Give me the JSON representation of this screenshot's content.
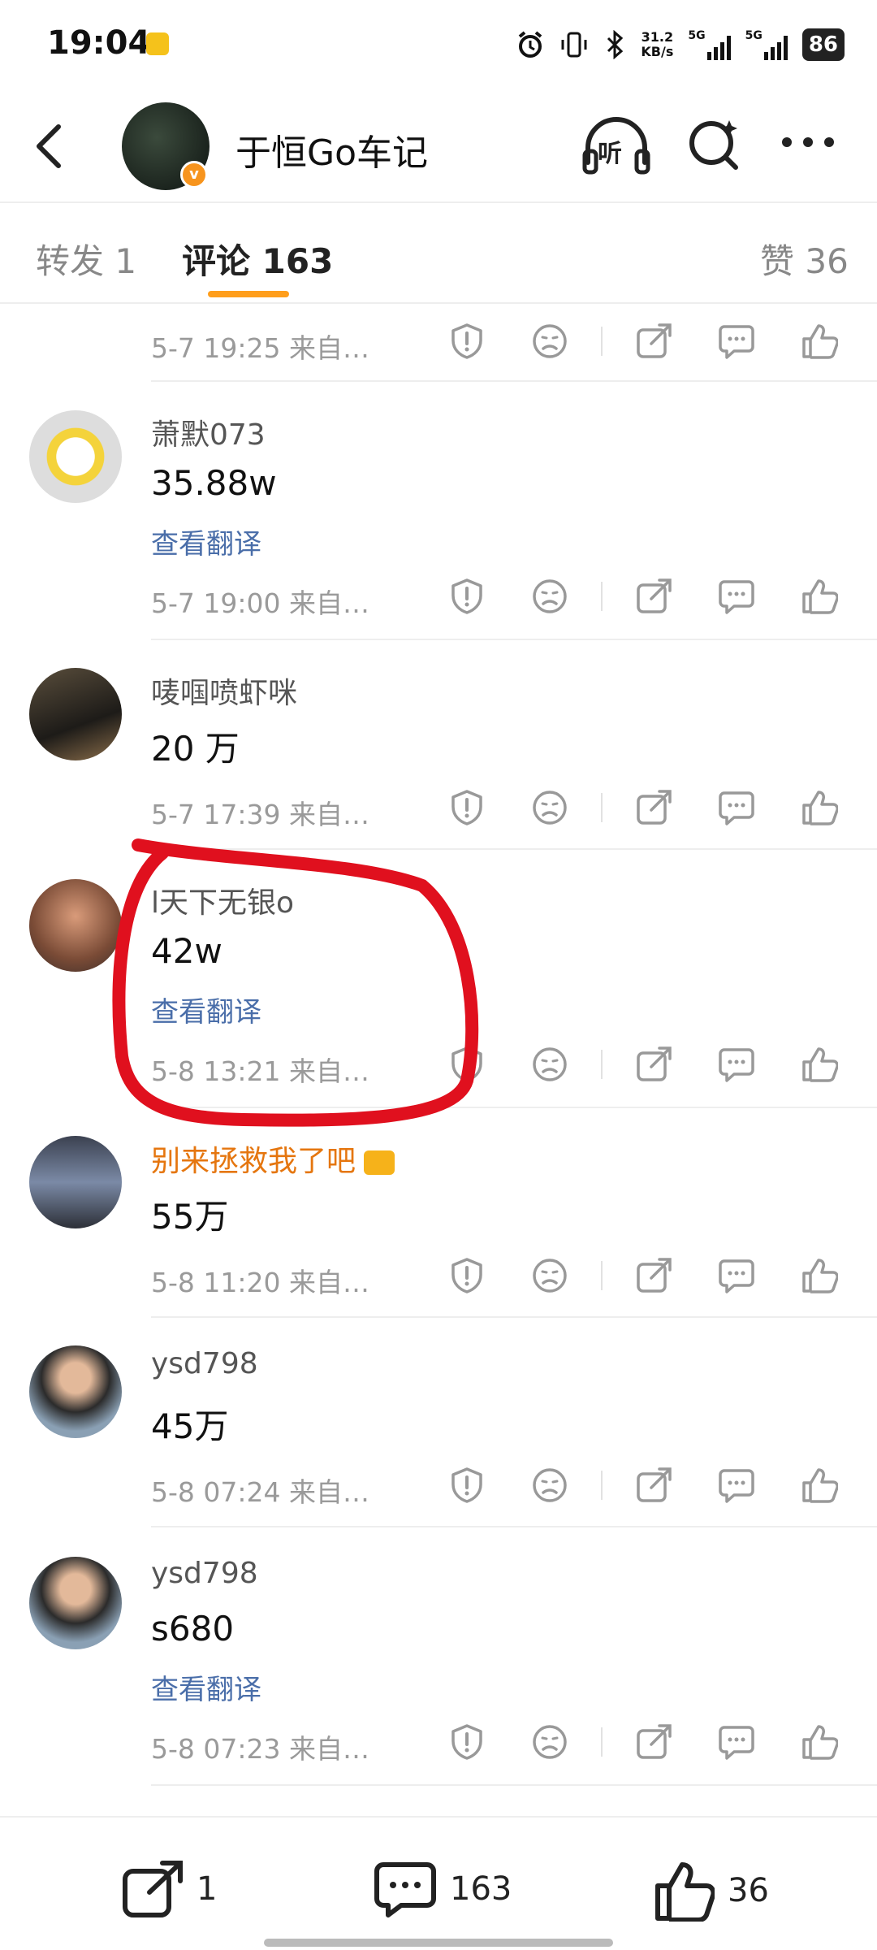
{
  "status": {
    "time": "19:04",
    "speed_top": "31.2",
    "speed_unit": "KB/s",
    "sig1": "5G",
    "sig2": "5G",
    "battery": "86"
  },
  "header": {
    "title": "于恒Go车记",
    "listen_label": "听",
    "verified": "v"
  },
  "tabs": [
    {
      "label": "转发 1"
    },
    {
      "label": "评论 163"
    },
    {
      "label": "赞 36"
    }
  ],
  "comments": [
    {
      "name": "",
      "text": "",
      "translate": "",
      "meta": "5-7 19:25  来自…"
    },
    {
      "name": "萧默073",
      "text": "35.88w",
      "translate": "查看翻译",
      "meta": "5-7 19:00  来自…"
    },
    {
      "name": "唛啯喷虾咪",
      "text": "20 万",
      "translate": "",
      "meta": "5-7 17:39  来自…"
    },
    {
      "name": "l天下无银o",
      "text": "42w",
      "translate": "查看翻译",
      "meta": "5-8 13:21  来自…"
    },
    {
      "name": "别来拯救我了吧",
      "text": "55万",
      "translate": "",
      "meta": "5-8 11:20  来自…"
    },
    {
      "name": "ysd798",
      "text": "45万",
      "translate": "",
      "meta": "5-8 07:24  来自…"
    },
    {
      "name": "ysd798",
      "text": "s680",
      "translate": "查看翻译",
      "meta": "5-8 07:23  来自…"
    }
  ],
  "bottom": {
    "repost": "1",
    "comment": "163",
    "like": "36"
  },
  "colors": {
    "accent": "#ff9e1b",
    "link": "#4a6ea9",
    "highlight": "#e0101e",
    "vip_name": "#e5760f"
  }
}
